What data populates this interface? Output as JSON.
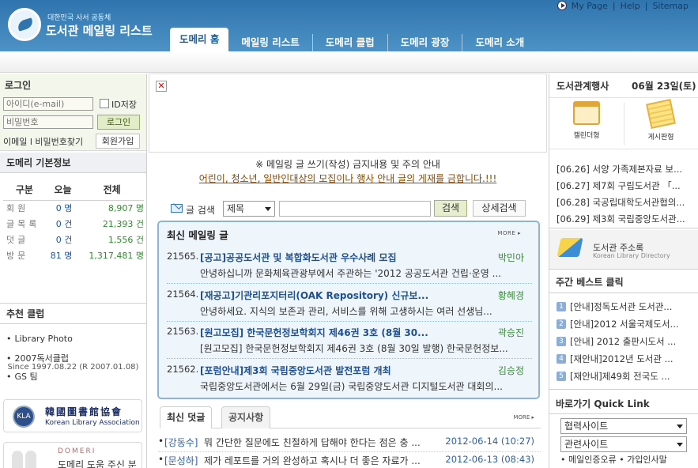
{
  "header": {
    "logo_sub": "대한민국 사서 공동체",
    "logo_main": "도서관 메일링 리스트",
    "util_links": [
      "My Page",
      "Help",
      "Sitemap"
    ],
    "tabs": [
      "도메리 홈",
      "메일링 리스트",
      "도메리 클럽",
      "도메리 광장",
      "도메리 소개"
    ]
  },
  "login": {
    "title": "로그인",
    "id_placeholder": "아이디(e-mail)",
    "pw_placeholder": "비밀번호",
    "save_id_label": "ID저장",
    "login_button": "로그인",
    "find_links": "이메일 l 비밀번호찾기",
    "join_button": "회원가입"
  },
  "stats": {
    "title": "도메리 기본정보",
    "headers": [
      "구분",
      "오늘",
      "전체"
    ],
    "rows": [
      {
        "label": "회원",
        "today": "0 명",
        "total": "8,907 명"
      },
      {
        "label": "글목록",
        "today": "0 건",
        "total": "21,393 건"
      },
      {
        "label": "덧글",
        "today": "0 건",
        "total": "1,556 건"
      },
      {
        "label": "방문",
        "today": "81 명",
        "total": "1,317,481 명"
      }
    ],
    "since": "Since 1997.08.22 (R 2007.01.08)"
  },
  "club": {
    "title": "추천 클럽",
    "items": [
      "Library Photo",
      "2007독서클럽",
      "GS 팀"
    ]
  },
  "kla": {
    "seal": "KLA",
    "name_kr": "韓國圖書館協會",
    "name_en": "Korean Library Association"
  },
  "domeri_banner": {
    "label": "DOMERI",
    "text": "도메리 도움 주신 분"
  },
  "center": {
    "broken_image": "✕",
    "notice_line1": "※ 메일링 글 쓰기(작성) 금지내용 및 주의 안내",
    "notice_line2": "어린이, 청소년, 일반인대상의 모집이나 행사 안내 글의 게재를 금합니다.!!!",
    "search": {
      "label": "글 검색",
      "field_option": "제목",
      "query": "",
      "search_button": "검색",
      "advanced_button": "상세검색"
    },
    "latest": {
      "title": "최신 메일링 글",
      "more": "MORE",
      "posts": [
        {
          "num": "21565.",
          "subject": "[공고]공공도서관 및 복합화도서관 우수사례 모집",
          "author": "박민아",
          "body": "안녕하십니까 문화체육관광부에서 주관하는 '2012 공공도서관 건립·운영 ..."
        },
        {
          "num": "21564.",
          "subject": "[재공고]기관리포지터리(OAK Repository) 신규보...",
          "author": "황혜경",
          "body": "안녕하세요. 지식의 보존과 관리, 서비스를 위해 고생하시는 여러 선생님..."
        },
        {
          "num": "21563.",
          "subject": "[원고모집] 한국문헌정보학회지 제46권 3호 (8월 30...",
          "author": "곽승진",
          "body": "[원고모집] 한국문헌정보학회지 제46권 3호 (8월 30일 발행) 한국문헌정보..."
        },
        {
          "num": "21562.",
          "subject": "[포럼안내]제3회 국립중앙도서관 발전포럼 개최",
          "author": "김승정",
          "body": "국립중앙도서관에서는 6월 29일(금) 국립중앙도서관 디지털도서관 대회의..."
        }
      ]
    },
    "lower_tabs": [
      "최신 덧글",
      "공지사항"
    ],
    "lower_more": "MORE",
    "comments": [
      {
        "who": "[강동수]",
        "text": "뭐 간단한 질문에도 친절하게 답해야 한다는 점은 충 ...",
        "date": "2012-06-14 (10:27)"
      },
      {
        "who": "[문성하]",
        "text": "제가 레포트를 거의 완성하고 혹시나 더 좋은 자료가 ...",
        "date": "2012-06-13 (08:43)"
      }
    ]
  },
  "right": {
    "events_title": "도서관계행사",
    "events_date": "06월 23일(토)",
    "calendar_caption": "캘린더형",
    "board_caption": "게시판형",
    "events": [
      "[06.26] 서양 가족제본자료 보...",
      "[06.27] 제7회 구립도서관 「...",
      "[06.28] 국공립대학도서관협의...",
      "[06.29] 제3회 국립중앙도서관..."
    ],
    "directory_title": "도서관 주소록",
    "directory_sub": "Korean Library Directory",
    "best_title": "주간 베스트 클릭",
    "best": [
      {
        "rank": "1",
        "text": "[안내]정독도서관 도서관..."
      },
      {
        "rank": "2",
        "text": "[안내]2012 서울국제도서..."
      },
      {
        "rank": "3",
        "text": "[안내] 2012 출판시도서 ..."
      },
      {
        "rank": "4",
        "text": "[재안내]2012년 도서관 ..."
      },
      {
        "rank": "5",
        "text": "[재안내]제49회 전국도 ..."
      }
    ],
    "quick_title": "바로가기 Quick Link",
    "quick_selects": [
      "협력사이트",
      "관련사이트"
    ],
    "footer_links": "• 메일인증오류 • 가입인사말"
  },
  "colors": {
    "header_blue": "#2f74ad",
    "link_blue": "#1f4f93",
    "author_green": "#3d8a3d",
    "notice_brown": "#8a4a00"
  }
}
